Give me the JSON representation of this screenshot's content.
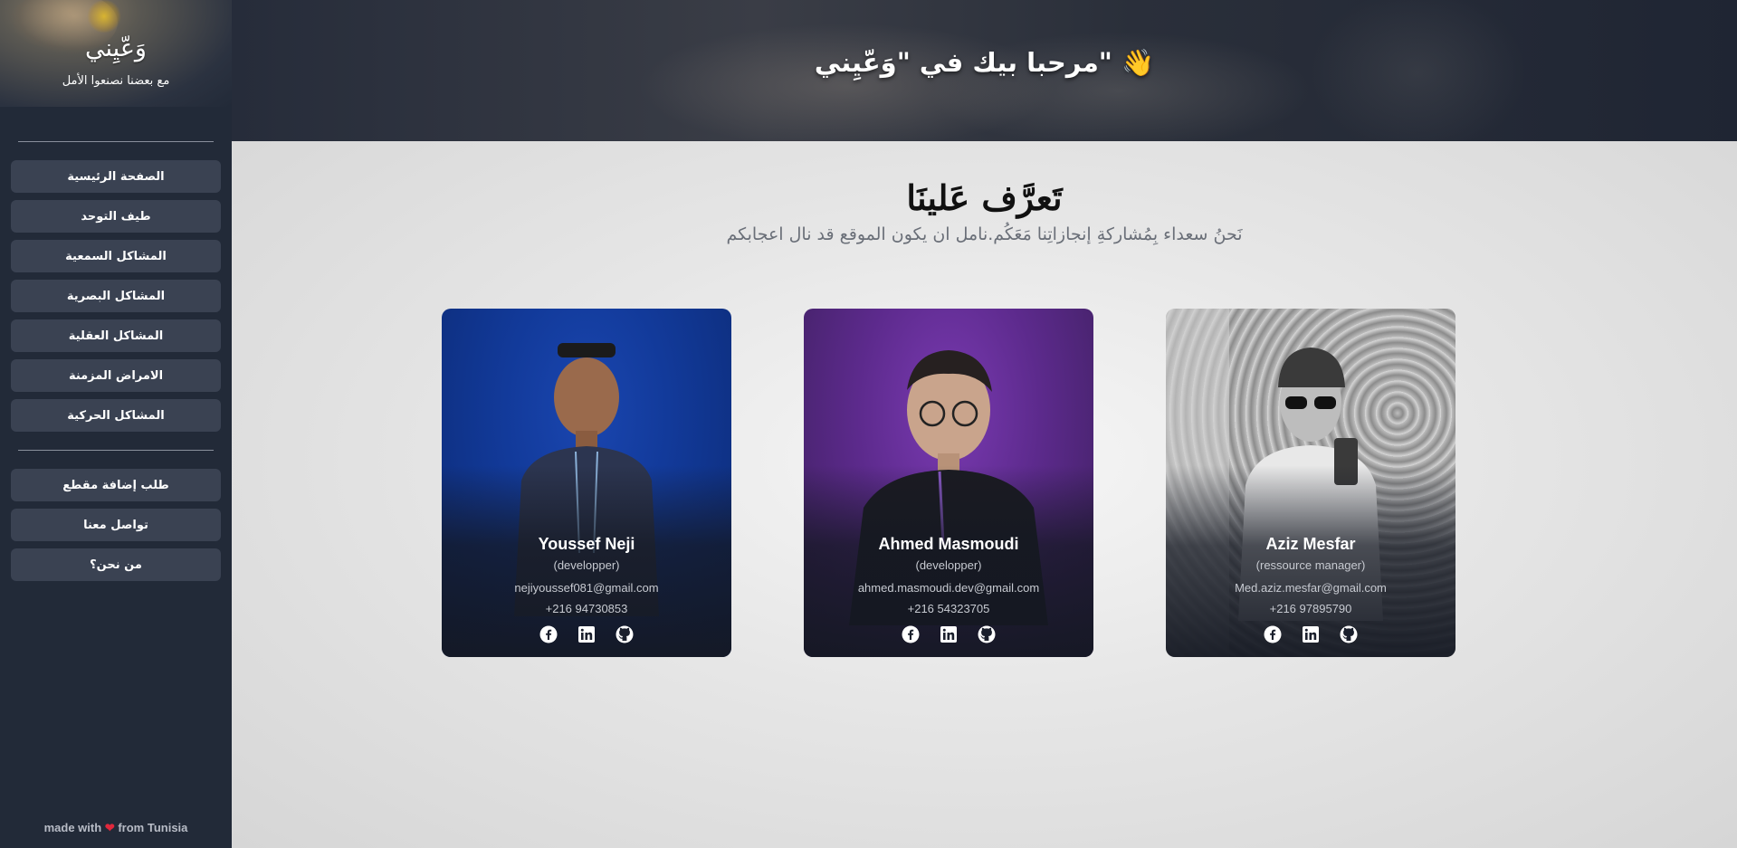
{
  "sidebar": {
    "logo": "وَعّيِني",
    "tagline": "مع بعضنا نصنعوا الأمل",
    "nav": [
      {
        "label": "الصفحة الرئيسية"
      },
      {
        "label": "طيف التوحد"
      },
      {
        "label": "المشاكل السمعية"
      },
      {
        "label": "المشاكل البصرية"
      },
      {
        "label": "المشاكل العقلية"
      },
      {
        "label": "الامراض المزمنة"
      },
      {
        "label": "المشاكل الحركية"
      }
    ],
    "actions": [
      {
        "label": "طلب إضافة مقطع"
      },
      {
        "label": "تواصل معنا"
      },
      {
        "label": "من نحن؟"
      }
    ],
    "footer": {
      "made_with": "made with",
      "from": "from Tunisia"
    }
  },
  "banner": {
    "title": "مرحبا بيك في \"وَعّيِني\" 👋"
  },
  "main": {
    "title": "تَعرَّف عَلينَا",
    "subtitle": "نَحنُ سعداء بِمُشاركةِ إنجازاتِنا مَعَكُم.نامل ان يكون الموقع قد نال اعجابكم"
  },
  "team": [
    {
      "name": "Youssef Neji",
      "role": "(developper)",
      "email": "nejiyoussef081@gmail.com",
      "phone": "+216 94730853",
      "bg": "#0f2f86"
    },
    {
      "name": "Ahmed Masmoudi",
      "role": "(developper)",
      "email": "ahmed.masmoudi.dev@gmail.com",
      "phone": "+216 54323705",
      "bg": "#5a2a8a"
    },
    {
      "name": "Aziz Mesfar",
      "role": "(ressource manager)",
      "email": "Med.aziz.mesfar@gmail.com",
      "phone": "+216 97895790",
      "bg": "#9a9a9a"
    }
  ],
  "icons": {
    "facebook": "facebook-icon",
    "linkedin": "linkedin-icon",
    "github": "github-icon",
    "heart": "heart-icon"
  },
  "colors": {
    "sidebar": "#222a38",
    "nav_button": "#3a4252",
    "heart": "#e0283c"
  }
}
